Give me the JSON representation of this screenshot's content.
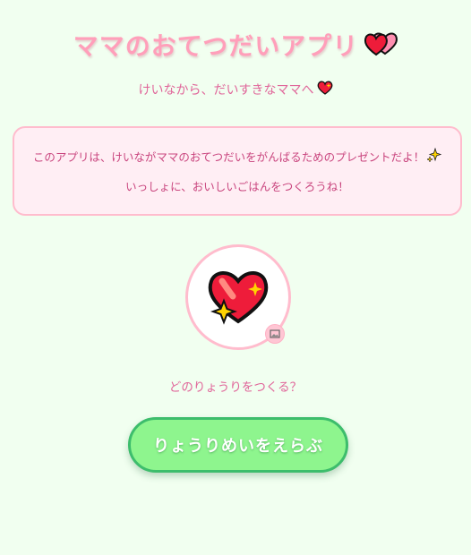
{
  "header": {
    "title": "ママのおてつだいアプリ",
    "title_icon": "two-hearts-icon",
    "subtitle": "けいなから、だいすきなママへ",
    "subtitle_icon": "sparkling-heart-icon"
  },
  "message": {
    "line1": "このアプリは、けいながママのおてつだいをがんばるためのプレゼントだよ！",
    "line1_icon": "sparkles-icon",
    "line2": "いっしょに、おいしいごはんをつくろうね！"
  },
  "avatar": {
    "icon": "sparkling-heart-icon",
    "badge_icon": "image-icon"
  },
  "prompt": {
    "question": "どのりょうりをつくる？"
  },
  "actions": {
    "choose_label": "りょうりめいをえらぶ"
  },
  "colors": {
    "background": "#f1fff0",
    "accent_pink": "#ff9fba",
    "text_pink": "#e0669a",
    "box_bg": "#ffeef4",
    "box_border": "#ffbccd",
    "button_green": "#8ef58e",
    "button_border": "#3dbd6c"
  }
}
